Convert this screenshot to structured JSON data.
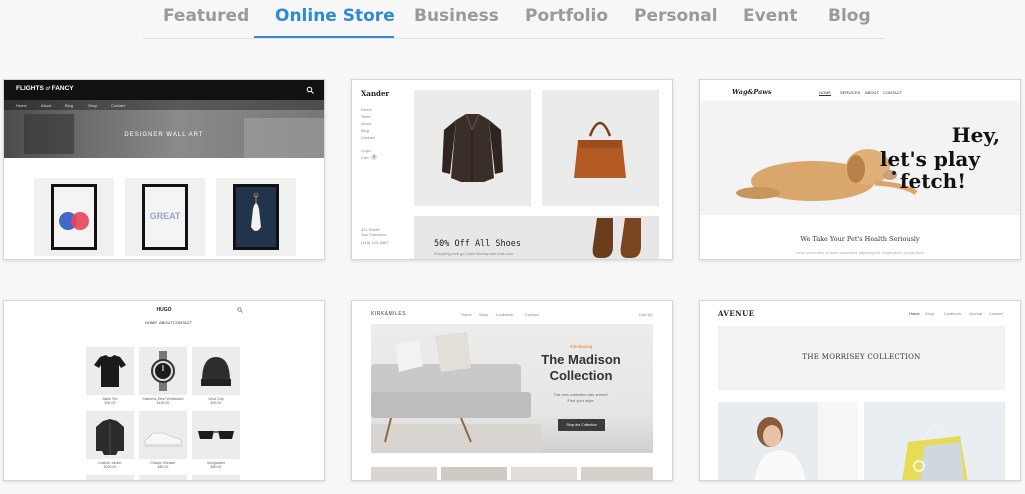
{
  "tabs": [
    {
      "label": "Featured",
      "active": false
    },
    {
      "label": "Online Store",
      "active": true
    },
    {
      "label": "Business",
      "active": false
    },
    {
      "label": "Portfolio",
      "active": false
    },
    {
      "label": "Personal",
      "active": false
    },
    {
      "label": "Event",
      "active": false
    },
    {
      "label": "Blog",
      "active": false
    }
  ],
  "colors": {
    "accent": "#2d8ad8",
    "tab_inactive": "#9a9a9a"
  },
  "templates": {
    "flights": {
      "logo_a": "FLIGHTS",
      "logo_of": "of",
      "logo_b": "FANCY",
      "nav": [
        "Home",
        "About",
        "Blog",
        "Shop",
        "Contact"
      ],
      "hero": "DESIGNER WALL ART",
      "poster_word": "GREAT"
    },
    "xander": {
      "logo": "Xander",
      "nav": [
        "Home",
        "Store",
        "About",
        "Blog",
        "Contact"
      ],
      "login": "Login",
      "cart": "Cart",
      "cart_count": "0",
      "banner": "50% Off All Shoes",
      "banner_sub": "Everything must go! Cyber Monday sale ends soon",
      "address": "321 Street",
      "city": "San Francisco",
      "phone": "(415) 123-4567"
    },
    "wagpaws": {
      "logo": "Wag&Paws",
      "nav": [
        "HOME",
        "SERVICES",
        "ABOUT",
        "CONTACT"
      ],
      "headline_1": "Hey,",
      "headline_2": "let's play",
      "headline_3": "fetch!",
      "tagline": "We Take Your Pet's Health Seriously",
      "body": "Lorem ipsum dolor sit amet, consectetur adipiscing elit. Suspendisse ut turpis dolor."
    },
    "hugo": {
      "logo": "HUGO",
      "nav": [
        "HOME",
        "ABOUT",
        "CONTACT"
      ],
      "products": [
        {
          "name": "Black Tee",
          "price": "$30.00"
        },
        {
          "name": "Stainless Steel Wristwatch",
          "price": "$150.00"
        },
        {
          "name": "Wool Cap",
          "price": "$25.00"
        },
        {
          "name": "Leather Jacket",
          "price": "$200.00"
        },
        {
          "name": "Classic Sneaker",
          "price": "$80.00"
        },
        {
          "name": "Sunglasses",
          "price": "$60.00"
        }
      ]
    },
    "kirkmiles": {
      "logo": "KIRK&MILES",
      "nav": [
        "Home",
        "Shop",
        "Lookbook",
        "Contact"
      ],
      "cart": "Cart (0)",
      "kicker": "Introducing",
      "title_1": "The Madison",
      "title_2": "Collection",
      "sub_1": "The new collection has arrived.",
      "sub_2": "Find your style.",
      "cta": "Shop the Collection"
    },
    "avenue": {
      "logo": "AVENUE",
      "nav": [
        "Home",
        "Shop",
        "Lookbook",
        "Journal",
        "Contact"
      ],
      "hero": "THE MORRISEY COLLECTION"
    }
  }
}
